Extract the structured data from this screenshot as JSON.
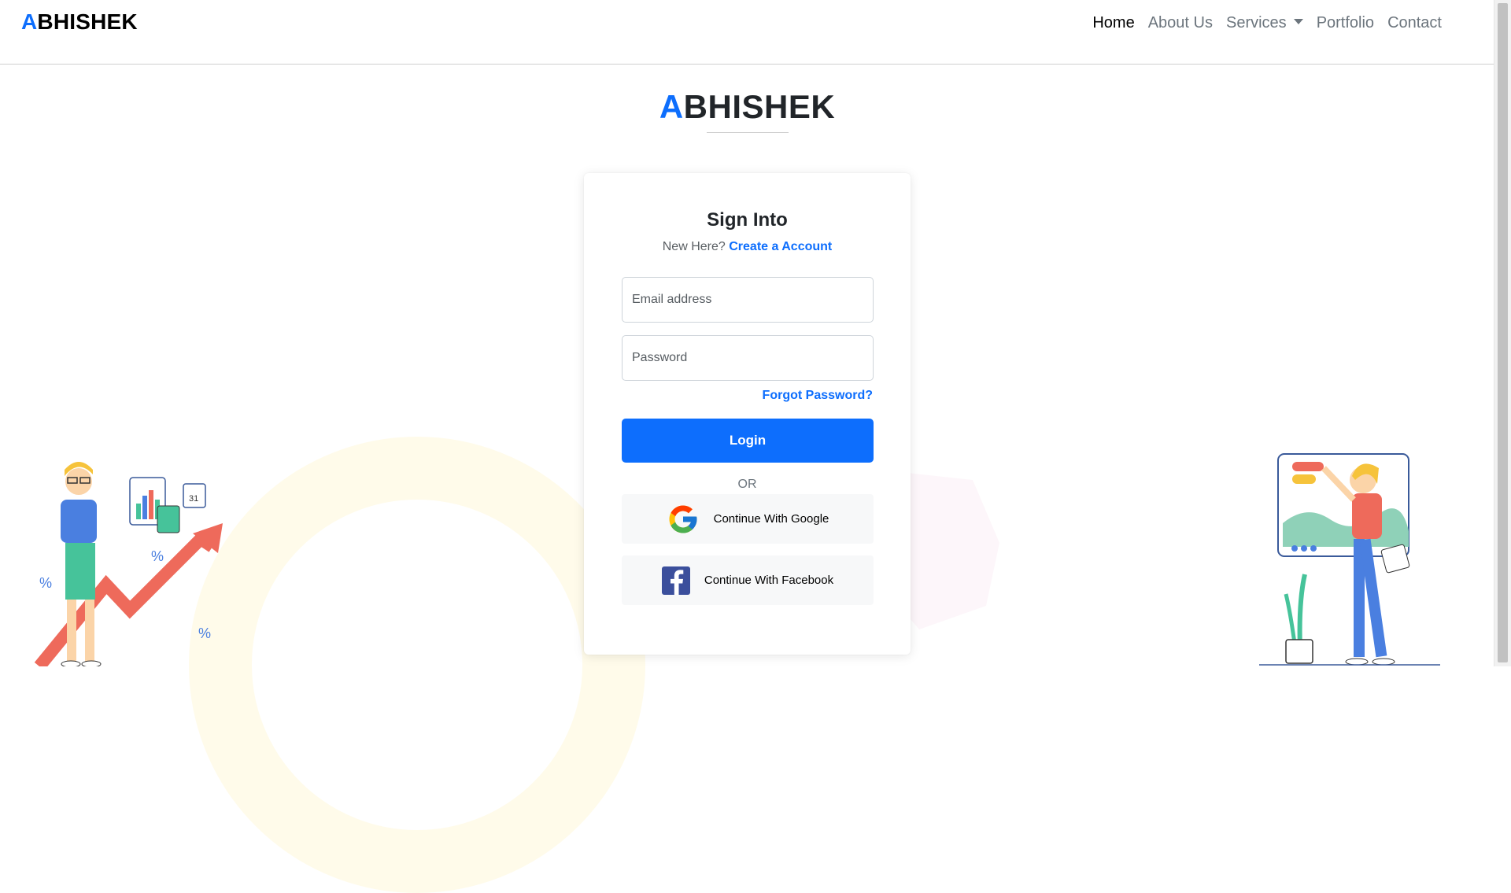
{
  "navbar": {
    "brand_accent": "A",
    "brand_rest": "BHISHEK",
    "links": [
      {
        "label": "Home",
        "active": true
      },
      {
        "label": "About Us"
      },
      {
        "label": "Services",
        "dropdown": true
      },
      {
        "label": "Portfolio"
      },
      {
        "label": "Contact"
      }
    ]
  },
  "hero": {
    "brand_accent": "A",
    "brand_rest": "BHISHEK"
  },
  "login": {
    "title": "Sign Into",
    "new_here": "New Here?",
    "create_account": "Create a Account",
    "email_placeholder": "Email address",
    "password_placeholder": "Password",
    "forgot_password": "Forgot Password?",
    "login_button": "Login",
    "or": "OR",
    "google_button": "Continue With Google",
    "facebook_button": "Continue With Facebook"
  },
  "icons": {
    "google": "google-icon",
    "facebook": "facebook-icon",
    "services_dropdown": "chevron-down-icon"
  },
  "colors": {
    "accent": "#0d6efd",
    "facebook": "#3b4f9c",
    "text": "#212529",
    "muted": "#6c757d"
  }
}
